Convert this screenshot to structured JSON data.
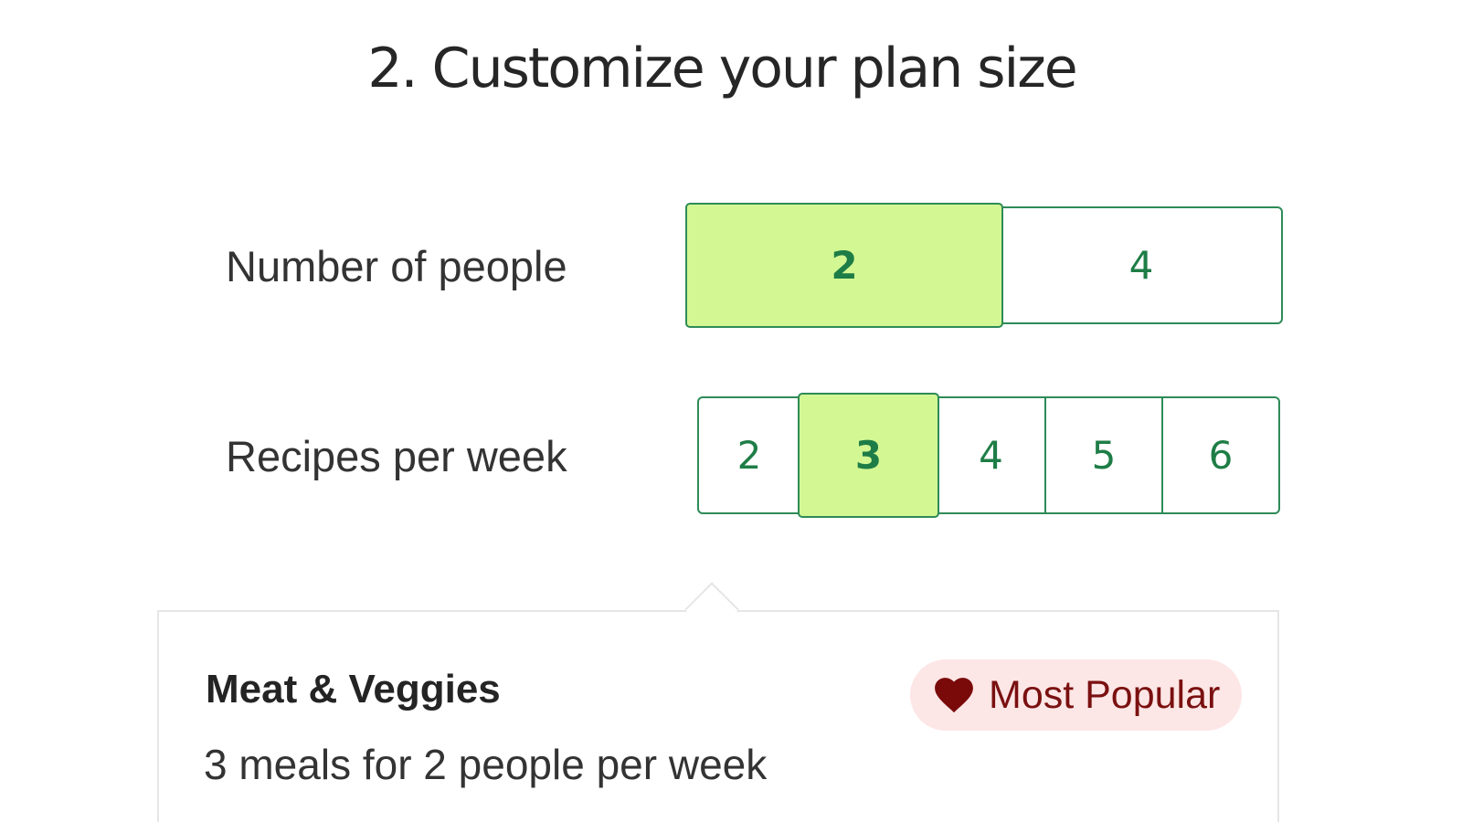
{
  "title": "2. Customize your plan size",
  "people": {
    "label": "Number of people",
    "options": [
      "2",
      "4"
    ],
    "selected": "2"
  },
  "recipes": {
    "label": "Recipes per week",
    "options": [
      "2",
      "3",
      "4",
      "5",
      "6"
    ],
    "selected": "3"
  },
  "plan": {
    "name": "Meat & Veggies",
    "description": "3 meals for 2 people per week",
    "badge_icon": "heart-icon",
    "badge_label": "Most Popular"
  },
  "colors": {
    "accent_border": "#2e8b57",
    "selected_fill": "#d3f793",
    "option_text": "#1e7d46",
    "badge_bg": "#fde6e6",
    "badge_text": "#7a1010"
  }
}
